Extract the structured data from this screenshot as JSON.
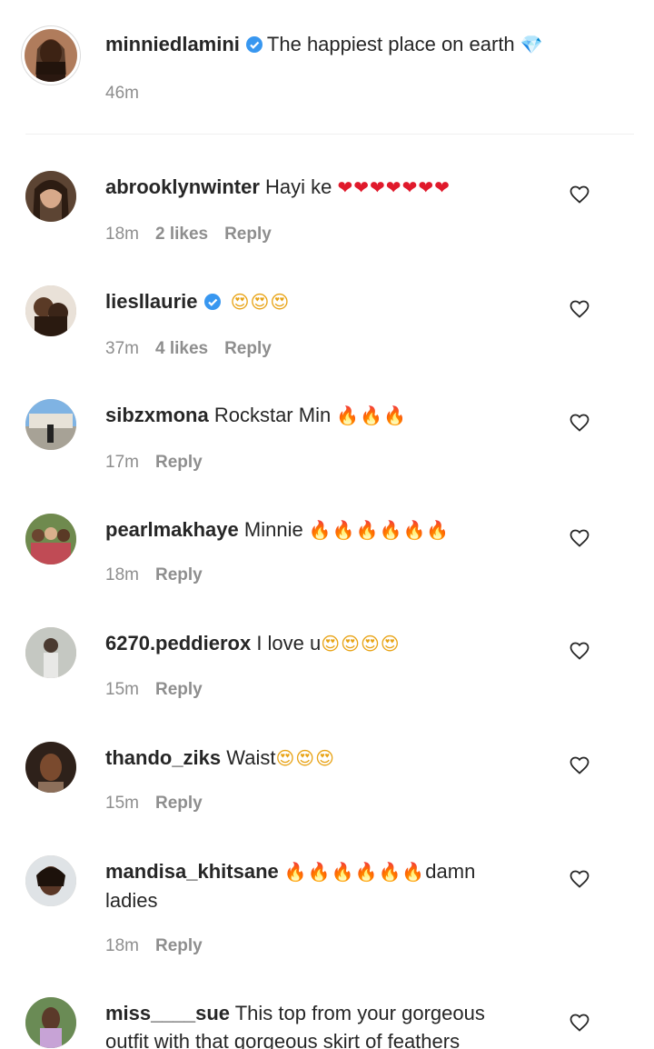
{
  "caption": {
    "username": "minniedlamini",
    "text": "The happiest place on earth",
    "emoji": "💎",
    "time": "46m",
    "verified": true
  },
  "comments": [
    {
      "username": "abrooklynwinter",
      "text": "Hayi ke",
      "emoji": "❤❤❤❤❤❤❤",
      "emoji_kind": "heart",
      "time": "18m",
      "likes": "2 likes",
      "reply": "Reply",
      "verified": false
    },
    {
      "username": "liesllaurie",
      "text": "",
      "emoji": "😍😍😍",
      "emoji_kind": "smile",
      "time": "37m",
      "likes": "4 likes",
      "reply": "Reply",
      "verified": true
    },
    {
      "username": "sibzxmona",
      "text": "Rockstar Min",
      "emoji": "🔥🔥🔥",
      "emoji_kind": "fire",
      "time": "17m",
      "likes": "",
      "reply": "Reply",
      "verified": false
    },
    {
      "username": "pearlmakhaye",
      "text": "Minnie",
      "emoji": "🔥🔥🔥🔥🔥🔥",
      "emoji_kind": "fire",
      "time": "18m",
      "likes": "",
      "reply": "Reply",
      "verified": false
    },
    {
      "username": "6270.peddierox",
      "text": "I love u",
      "emoji": "😍😍😍😍",
      "emoji_kind": "smile",
      "time": "15m",
      "likes": "",
      "reply": "Reply",
      "verified": false
    },
    {
      "username": "thando_ziks",
      "text": "Waist",
      "emoji": "😍😍😍",
      "emoji_kind": "smile",
      "time": "15m",
      "likes": "",
      "reply": "Reply",
      "verified": false
    },
    {
      "username": "mandisa_khitsane",
      "text": "",
      "emoji": "🔥🔥🔥🔥🔥🔥",
      "emoji_kind": "fire",
      "text_after": "damn ladies",
      "time": "18m",
      "likes": "",
      "reply": "Reply",
      "verified": false
    },
    {
      "username": "miss____sue",
      "text": "This top from your gorgeous outfit with that gorgeous skirt of feathers",
      "emoji": "",
      "emoji_kind": "",
      "time": "",
      "likes": "",
      "reply": "",
      "verified": false
    }
  ],
  "icons": {
    "like": "heart-outline-icon",
    "verified": "verified-badge-icon"
  },
  "colors": {
    "text": "#262626",
    "meta": "#8e8e8e",
    "verified": "#3897f0",
    "divider": "#efefef"
  }
}
